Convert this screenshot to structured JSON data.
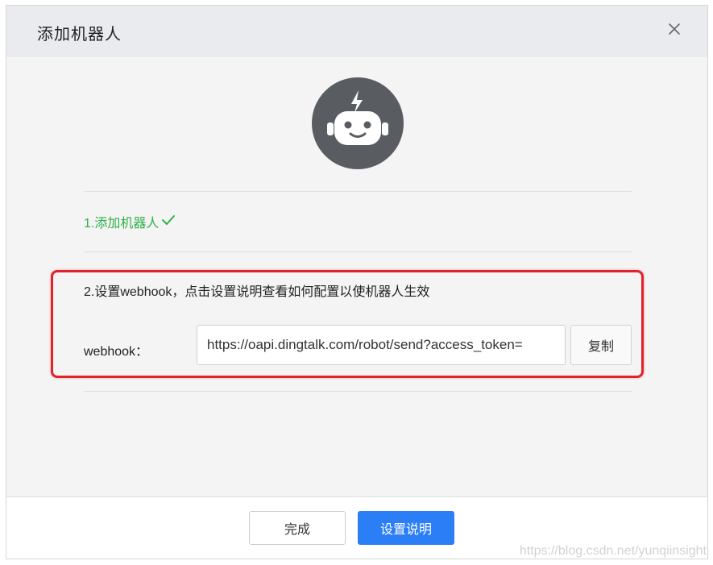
{
  "dialog": {
    "title": "添加机器人",
    "close_icon": "close-icon"
  },
  "avatar": {
    "icon": "robot-icon",
    "bg_color": "#595c61"
  },
  "step1": {
    "label": "1.添加机器人",
    "status_icon": "checkmark-icon",
    "color": "#2fb04a"
  },
  "step2": {
    "label": "2.设置webhook，点击设置说明查看如何配置以使机器人生效"
  },
  "webhook": {
    "label": "webhook：",
    "value": "https://oapi.dingtalk.com/robot/send?access_token=",
    "copy_label": "复制"
  },
  "footer": {
    "done_label": "完成",
    "help_label": "设置说明",
    "primary_color": "#2b7ef6"
  },
  "highlight_color": "#e0232a",
  "watermark": "https://blog.csdn.net/yunqiinsight"
}
